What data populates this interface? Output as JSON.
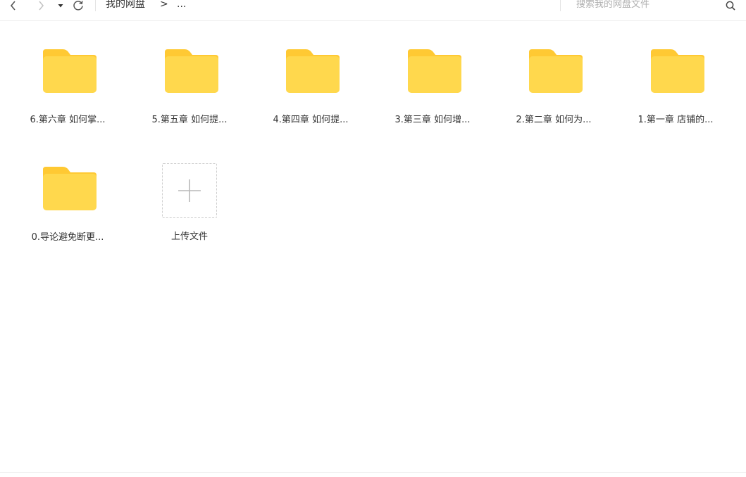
{
  "toolbar": {
    "back_icon": "chevron-left-icon",
    "forward_icon": "chevron-right-icon",
    "dropdown_icon": "caret-down-icon",
    "refresh_icon": "refresh-icon",
    "breadcrumb_root": "我的网盘",
    "breadcrumb_separator": ">",
    "breadcrumb_more": "...",
    "search_placeholder": "搜索我的网盘文件",
    "search_icon": "search-icon"
  },
  "folders": [
    {
      "name": "6.第六章 如何掌..."
    },
    {
      "name": "5.第五章 如何提..."
    },
    {
      "name": "4.第四章 如何提..."
    },
    {
      "name": "3.第三章 如何增..."
    },
    {
      "name": "2.第二章 如何为..."
    },
    {
      "name": "1.第一章 店铺的..."
    },
    {
      "name": "0.导论避免断更..."
    }
  ],
  "upload": {
    "label": "上传文件",
    "icon": "plus-icon"
  },
  "colors": {
    "folder_body": "#FFD84D",
    "folder_tab": "#FFC933",
    "divider": "#eeeeee"
  }
}
